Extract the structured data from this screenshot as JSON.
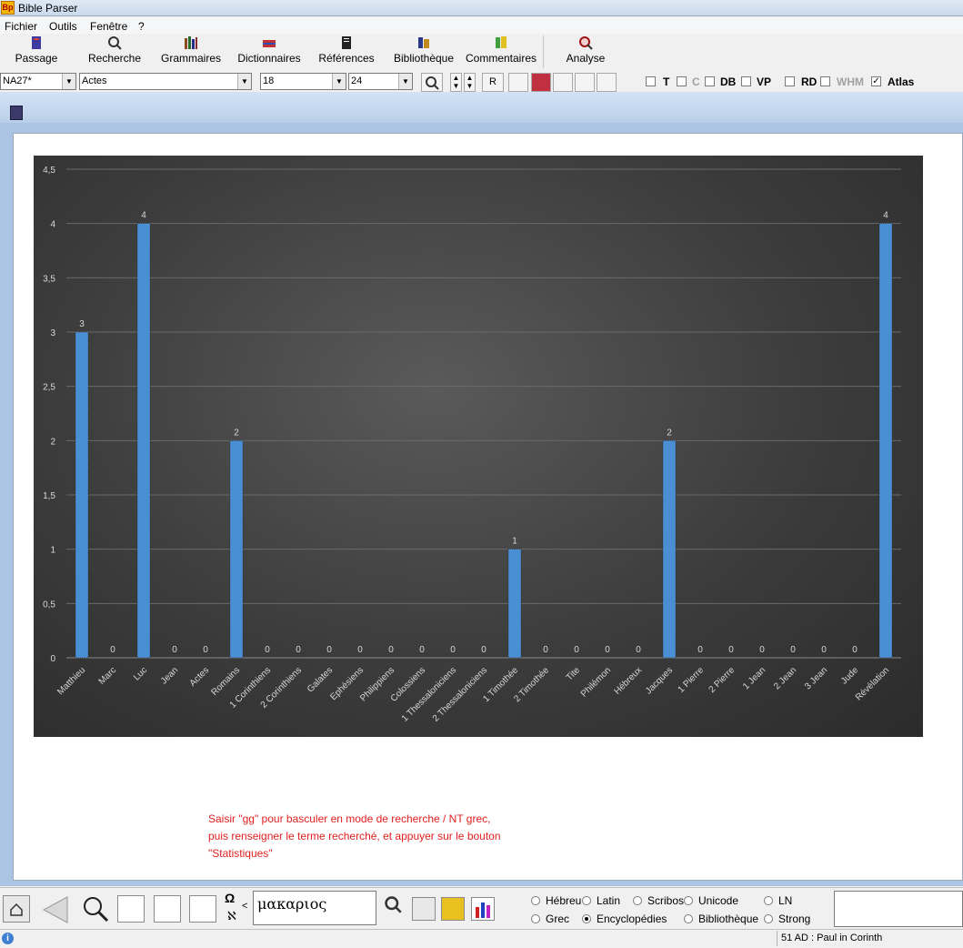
{
  "window": {
    "title": "Bible Parser",
    "app_icon": "Bp"
  },
  "menu": [
    "Fichier",
    "Outils",
    "Fenêtre",
    "?"
  ],
  "toolbar": {
    "buttons": [
      {
        "label": "Passage",
        "icon": "book-icon"
      },
      {
        "label": "Recherche",
        "icon": "search-icon"
      },
      {
        "label": "Grammaires",
        "icon": "books-icon"
      },
      {
        "label": "Dictionnaires",
        "icon": "dictionary-icon"
      },
      {
        "label": "Références",
        "icon": "references-icon"
      },
      {
        "label": "Bibliothèque",
        "icon": "library-icon"
      },
      {
        "label": "Commentaires",
        "icon": "commentary-icon"
      },
      {
        "label": "Analyse",
        "icon": "analysis-icon"
      }
    ]
  },
  "options": {
    "version": "NA27*",
    "book": "Actes",
    "chapter": "18",
    "verse": "24",
    "r_button": "R",
    "checkboxes": [
      {
        "label": "T",
        "checked": false,
        "enabled": true
      },
      {
        "label": "C",
        "checked": false,
        "enabled": false
      },
      {
        "label": "DB",
        "checked": false,
        "enabled": true
      },
      {
        "label": "VP",
        "checked": false,
        "enabled": true
      },
      {
        "label": "RD",
        "checked": false,
        "enabled": true
      },
      {
        "label": "WHM",
        "checked": false,
        "enabled": false
      },
      {
        "label": "Atlas",
        "checked": true,
        "enabled": true
      }
    ]
  },
  "chart_data": {
    "type": "bar",
    "categories": [
      "Matthieu",
      "Marc",
      "Luc",
      "Jean",
      "Actes",
      "Romains",
      "1 Corinthiens",
      "2 Corinthiens",
      "Galates",
      "Ephésiens",
      "Philippiens",
      "Colossiens",
      "1 Thessaloniciens",
      "2 Thessaloniciens",
      "1 Timothée",
      "2 Timothée",
      "Tite",
      "Philémon",
      "Hébreux",
      "Jacques",
      "1 Pierre",
      "2 Pierre",
      "1 Jean",
      "2 Jean",
      "3 Jean",
      "Jude",
      "Révélation"
    ],
    "values": [
      3,
      0,
      4,
      0,
      0,
      2,
      0,
      0,
      0,
      0,
      0,
      0,
      0,
      0,
      1,
      0,
      0,
      0,
      0,
      2,
      0,
      0,
      0,
      0,
      0,
      0,
      4
    ],
    "yticks": [
      "0",
      "0,5",
      "1",
      "1,5",
      "2",
      "2,5",
      "3",
      "3,5",
      "4",
      "4,5"
    ],
    "ylim": [
      0,
      4.5
    ],
    "grid": true,
    "bar_color": "#4a8fd4",
    "background": "#3c3c3c"
  },
  "note": {
    "lines": [
      "Saisir \"gg\" pour basculer en mode de recherche / NT grec,",
      "puis renseigner le terme recherché, et appuyer sur le bouton",
      "\"Statistiques\""
    ]
  },
  "bottom": {
    "omega": "Ω",
    "aleph": "ℵ",
    "lt": "<",
    "search_value": "μακαριος",
    "radios": [
      {
        "label": "Hébreu",
        "checked": false
      },
      {
        "label": "Latin",
        "checked": false
      },
      {
        "label": "Scribos",
        "checked": false
      },
      {
        "label": "Unicode",
        "checked": false
      },
      {
        "label": "LN",
        "checked": false
      },
      {
        "label": "Grec",
        "checked": false
      },
      {
        "label": "Encyclopédies",
        "checked": true
      },
      {
        "label": "Bibliothèque",
        "checked": false
      },
      {
        "label": "Strong",
        "checked": false
      }
    ]
  },
  "status": {
    "info": "i",
    "text": "51 AD : Paul in Corinth"
  }
}
